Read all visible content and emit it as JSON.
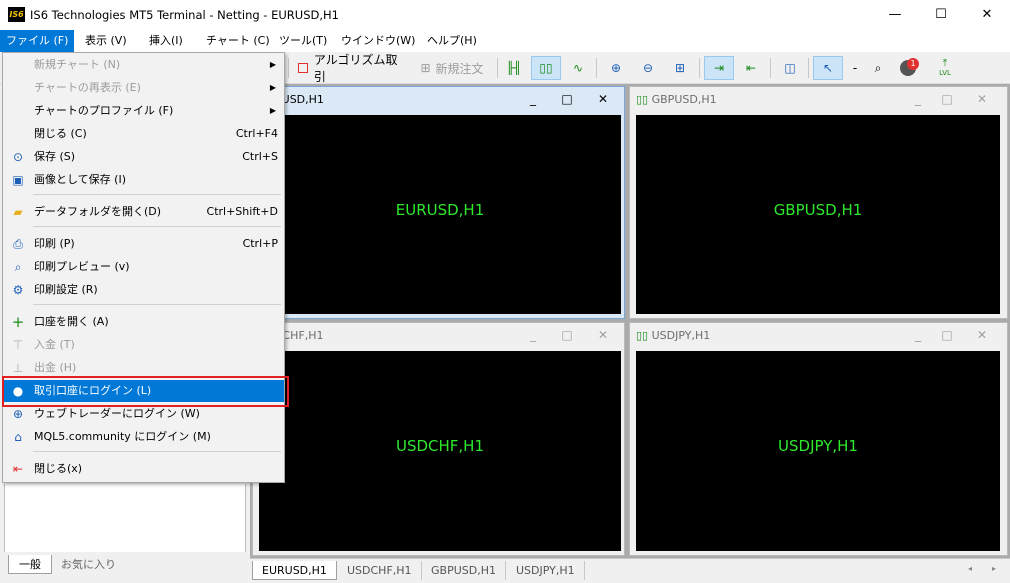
{
  "window": {
    "logo_text": "IS6",
    "title": "IS6 Technologies MT5 Terminal - Netting - EURUSD,H1",
    "minimize": "—",
    "maximize": "☐",
    "close": "✕"
  },
  "menubar": [
    {
      "label": "ファイル (F)"
    },
    {
      "label": "表示 (V)"
    },
    {
      "label": "挿入(I)"
    },
    {
      "label": "チャート (C)"
    },
    {
      "label": "ツール(T)"
    },
    {
      "label": "ウインドウ(W)"
    },
    {
      "label": "ヘルプ(H)"
    }
  ],
  "toolbar": {
    "algo_trading_label": "アルゴリズム取引",
    "new_order_label": "新規注文",
    "notification_count": "1",
    "lvl_label": "LVL",
    "dash": "-"
  },
  "file_menu": {
    "items": [
      {
        "label": "新規チャート (N)",
        "shortcut": "",
        "submenu": true,
        "disabled": true
      },
      {
        "label": "チャートの再表示 (E)",
        "shortcut": "",
        "submenu": true,
        "disabled": true
      },
      {
        "label": "チャートのプロファイル (F)",
        "shortcut": "",
        "submenu": true,
        "disabled": false
      },
      {
        "label": "閉じる (C)",
        "shortcut": "Ctrl+F4",
        "submenu": false,
        "disabled": false
      },
      {
        "label": "保存 (S)",
        "shortcut": "Ctrl+S",
        "submenu": false,
        "disabled": false
      },
      {
        "label": "画像として保存 (I)",
        "shortcut": "",
        "submenu": false,
        "disabled": false
      },
      {
        "label": "データフォルダを開く(D)",
        "shortcut": "Ctrl+Shift+D",
        "submenu": false,
        "disabled": false
      },
      {
        "label": "印刷 (P)",
        "shortcut": "Ctrl+P",
        "submenu": false,
        "disabled": false
      },
      {
        "label": "印刷プレビュー (v)",
        "shortcut": "",
        "submenu": false,
        "disabled": false
      },
      {
        "label": "印刷設定 (R)",
        "shortcut": "",
        "submenu": false,
        "disabled": false
      },
      {
        "label": "口座を開く (A)",
        "shortcut": "",
        "submenu": false,
        "disabled": false
      },
      {
        "label": "入金 (T)",
        "shortcut": "",
        "submenu": false,
        "disabled": true
      },
      {
        "label": "出金 (H)",
        "shortcut": "",
        "submenu": false,
        "disabled": true
      },
      {
        "label": "取引口座にログイン (L)",
        "shortcut": "",
        "submenu": false,
        "disabled": false,
        "highlighted": true
      },
      {
        "label": "ウェブトレーダーにログイン (W)",
        "shortcut": "",
        "submenu": false,
        "disabled": false
      },
      {
        "label": "MQL5.community にログイン (M)",
        "shortcut": "",
        "submenu": false,
        "disabled": false
      },
      {
        "label": "閉じる(x)",
        "shortcut": "",
        "submenu": false,
        "disabled": false
      }
    ]
  },
  "charts": [
    {
      "title": "EURUSD,H1",
      "label": "EURUSD,H1",
      "active": true
    },
    {
      "title": "GBPUSD,H1",
      "label": "GBPUSD,H1",
      "active": false
    },
    {
      "title": "USDCHF,H1",
      "label": "USDCHF,H1",
      "active": false
    },
    {
      "title": "USDJPY,H1",
      "label": "USDJPY,H1",
      "active": false
    }
  ],
  "chart_window_buttons": {
    "minimize": "_",
    "maximize": "□",
    "close": "✕"
  },
  "bottom_tabs": [
    "EURUSD,H1",
    "USDCHF,H1",
    "GBPUSD,H1",
    "USDJPY,H1"
  ],
  "navigator_tabs": [
    "一般",
    "お気に入り"
  ],
  "colors": {
    "accent": "#0078d7",
    "chart_label": "#2ee82e",
    "highlight_frame": "#e02020"
  }
}
